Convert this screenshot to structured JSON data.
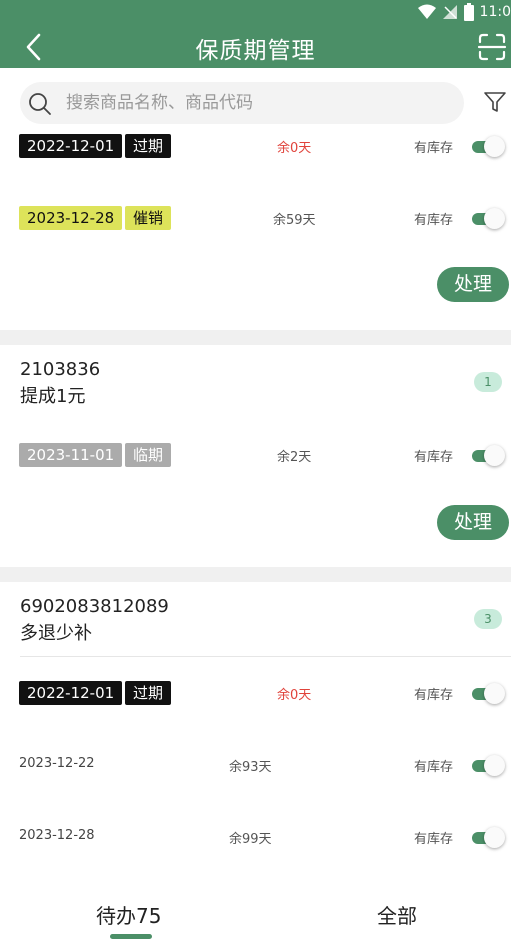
{
  "status_bar": {
    "time": "11:0"
  },
  "header": {
    "title": "保质期管理"
  },
  "search": {
    "placeholder": "搜索商品名称、商品代码"
  },
  "cards": [
    {
      "rows": [
        {
          "date": "2022-12-01",
          "tag": "过期",
          "remain": "余0天",
          "stock": "有库存"
        },
        {
          "date": "2023-12-28",
          "tag": "催销",
          "remain": "余59天",
          "stock": "有库存"
        }
      ],
      "action": "处理"
    },
    {
      "code": "2103836",
      "name": "提成1元",
      "count": "1",
      "rows": [
        {
          "date": "2023-11-01",
          "tag": "临期",
          "remain": "余2天",
          "stock": "有库存"
        }
      ],
      "action": "处理"
    },
    {
      "code": "6902083812089",
      "name": "多退少补",
      "count": "3",
      "rows": [
        {
          "date": "2022-12-01",
          "tag": "过期",
          "remain": "余0天",
          "stock": "有库存"
        },
        {
          "date": "2023-12-22",
          "tag": "",
          "remain": "余93天",
          "stock": "有库存"
        },
        {
          "date": "2023-12-28",
          "tag": "",
          "remain": "余99天",
          "stock": "有库存"
        }
      ]
    }
  ],
  "tabs": [
    {
      "label": "待办75"
    },
    {
      "label": "全部"
    }
  ],
  "colors": {
    "primary": "#4b8f67",
    "expired_tag": "#111111",
    "promo_tag": "#dde35a",
    "near_tag": "#ababab",
    "remain_red": "#e0433b"
  },
  "icons": [
    "back-icon",
    "scan-icon",
    "search-icon",
    "filter-icon",
    "wifi-icon",
    "signal-icon",
    "battery-icon"
  ]
}
